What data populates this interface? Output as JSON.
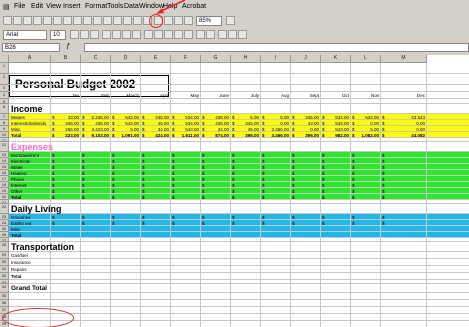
{
  "menu": [
    "File",
    "Edit",
    "View",
    "Insert",
    "Format",
    "Tools",
    "Data",
    "Window",
    "Help",
    "Acrobat"
  ],
  "toolbar2": {
    "font": "Arial",
    "size": "10",
    "zoom": "85%"
  },
  "namebox": "B26",
  "columns": [
    "A",
    "B",
    "C",
    "D",
    "E",
    "F",
    "G",
    "H",
    "I",
    "J",
    "K",
    "L",
    "M"
  ],
  "title": "Personal Budget 2002",
  "months": [
    "Jan",
    "Feb",
    "March",
    "April",
    "May",
    "June",
    "July",
    "Aug",
    "Sept",
    "Oct",
    "Nov",
    "Dec"
  ],
  "income": {
    "heading": "Income",
    "rows": [
      {
        "label": "Wages",
        "vals": [
          "43.00",
          "5,245.00",
          "543.00",
          "345.00",
          "534.00",
          "435.00",
          "5.00",
          "5.00",
          "345.00",
          "534.00",
          "534.00",
          "43,543"
        ]
      },
      {
        "label": "Interest/dividends",
        "vals": [
          "345.00",
          "435.00",
          "543.00",
          "45.00",
          "534.00",
          "435.00",
          "345.00",
          "0.00",
          "43.00",
          "543.00",
          "0.00",
          "0.00"
        ]
      },
      {
        "label": "Misc.",
        "vals": [
          "266.00",
          "3,423.00",
          "5.00",
          "34.00",
          "543.00",
          "34.00",
          "45.00",
          "3,456.00",
          "0.00",
          "543.00",
          "5.00",
          "0.00"
        ]
      },
      {
        "label": "Total",
        "vals": [
          "223.00",
          "9,103.00",
          "1,091.00",
          "424.00",
          "1,611.00",
          "874.00",
          "395.00",
          "3,466.00",
          "395.00",
          "982.00",
          "1,082.00",
          "44,082"
        ]
      }
    ]
  },
  "expenses": {
    "heading": "Expenses",
    "rows": [
      "Mortgage/rent",
      "Electricity",
      "Water",
      "Heating",
      "Phone",
      "Internet",
      "Other",
      "Total"
    ]
  },
  "daily": {
    "heading": "Daily Living",
    "rows": [
      "Groceries",
      "Eating out",
      "Misc",
      "Total"
    ]
  },
  "transport": {
    "heading": "Transportation",
    "rows": [
      "Gas/fuel",
      "Insurance",
      "Repairs",
      "Total"
    ]
  },
  "grandtotal": "Grand Total",
  "colors": {
    "income": "#ffff00",
    "expenses": "#2ee62e",
    "daily": "#1fb8e8",
    "annot": "#e0282e",
    "expense_heading": "#ff66cc"
  }
}
